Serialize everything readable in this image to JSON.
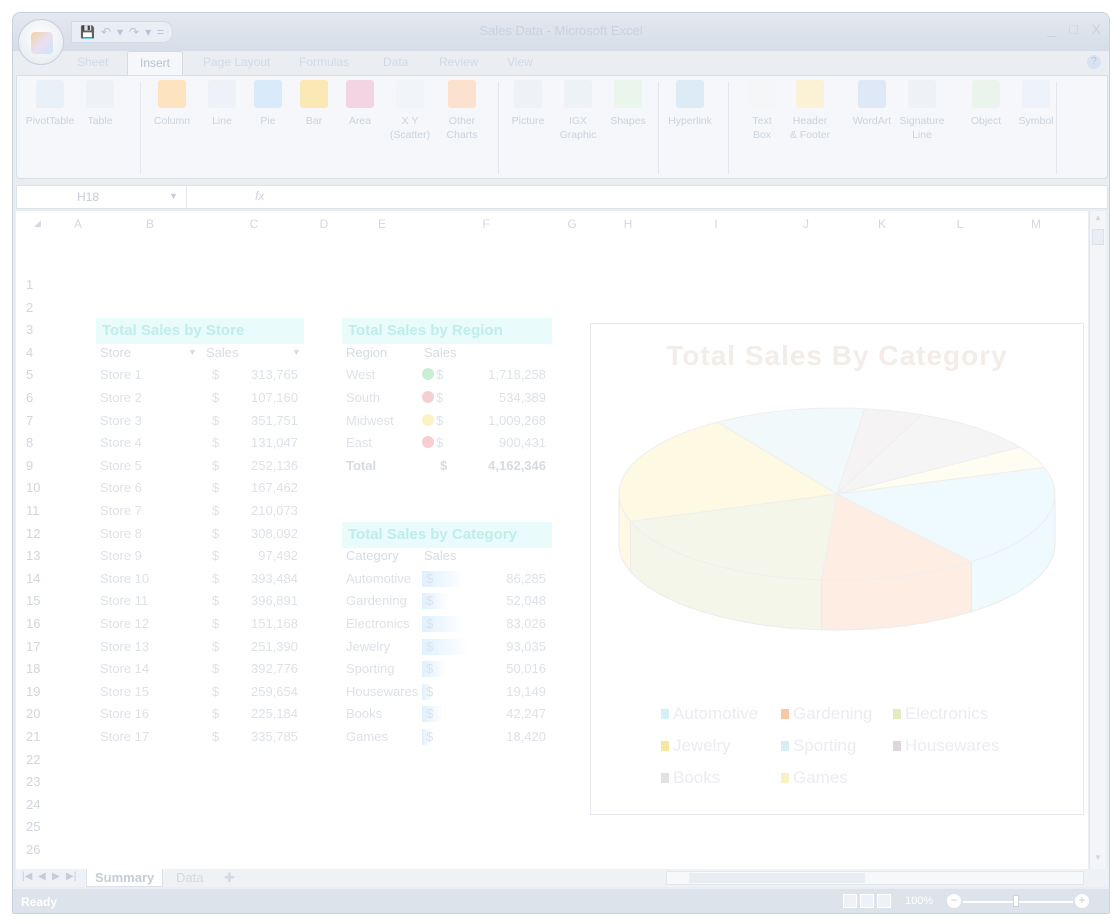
{
  "window": {
    "title": "Sales Data - Microsoft Excel",
    "controls": [
      "_",
      "□",
      "X"
    ]
  },
  "quick_access": [
    "💾",
    "↶",
    "▾",
    "↷",
    "▾",
    "="
  ],
  "tabs": [
    "Sheet",
    "Insert",
    "Page Layout",
    "Formulas",
    "Data",
    "Review",
    "View"
  ],
  "active_tab": "Insert",
  "ribbon": [
    {
      "label": "PivotTable",
      "icon": "pivottable-icon",
      "color": "#e9f0f7"
    },
    {
      "label": "Table",
      "icon": "table-icon",
      "color": "#eef2f7"
    },
    {
      "label": "Column",
      "icon": "column-chart-icon",
      "color": "#fde3c0"
    },
    {
      "label": "Line",
      "icon": "line-chart-icon",
      "color": "#eef2f8"
    },
    {
      "label": "Pie",
      "icon": "pie-chart-icon",
      "color": "#d9ebfa"
    },
    {
      "label": "Bar",
      "icon": "bar-chart-icon",
      "color": "#fbe9b5"
    },
    {
      "label": "Area",
      "icon": "area-chart-icon",
      "color": "#f3d4e2"
    },
    {
      "label": "X Y",
      "label2": "(Scatter)",
      "icon": "scatter-chart-icon",
      "color": "#f1f4f8"
    },
    {
      "label": "Other",
      "label2": "Charts",
      "icon": "other-charts-icon",
      "color": "#fbe2cf"
    },
    {
      "label": "Picture",
      "icon": "picture-icon",
      "color": "#eef2f7"
    },
    {
      "label": "IGX",
      "label2": "Graphic",
      "icon": "igx-graphic-icon",
      "color": "#edf2f7"
    },
    {
      "label": "Shapes",
      "icon": "shapes-icon",
      "color": "#eaf5ec"
    },
    {
      "label": "Hyperlink",
      "icon": "hyperlink-icon",
      "color": "#dcebf6"
    },
    {
      "label": "Text",
      "label2": "Box",
      "icon": "text-box-icon",
      "color": "#f4f6f8"
    },
    {
      "label": "Header",
      "label2": "& Footer",
      "icon": "header-footer-icon",
      "color": "#fbf2d6"
    },
    {
      "label": "WordArt",
      "icon": "wordart-icon",
      "color": "#dfe8f6"
    },
    {
      "label": "Signature",
      "label2": "Line",
      "icon": "signature-line-icon",
      "color": "#eef2f6"
    },
    {
      "label": "Object",
      "icon": "object-icon",
      "color": "#eaf4ec"
    },
    {
      "label": "Symbol",
      "icon": "symbol-icon",
      "color": "#eef2fa"
    }
  ],
  "formula_bar": {
    "name_box": "H18",
    "fx": "fx",
    "value": ""
  },
  "columns": [
    "A",
    "B",
    "C",
    "D",
    "E",
    "F",
    "G",
    "H",
    "I",
    "J",
    "K",
    "L",
    "M"
  ],
  "rows": [
    "1",
    "2",
    "3",
    "4",
    "5",
    "6",
    "7",
    "8",
    "9",
    "10",
    "11",
    "12",
    "13",
    "14",
    "15",
    "16",
    "17",
    "18",
    "19",
    "20",
    "21",
    "22",
    "23",
    "24",
    "25",
    "26"
  ],
  "store_table": {
    "title": "Total Sales by Store",
    "headers": [
      "Store",
      "Sales"
    ],
    "rows": [
      [
        "Store 1",
        "313,765"
      ],
      [
        "Store 2",
        "107,160"
      ],
      [
        "Store 3",
        "351,751"
      ],
      [
        "Store 4",
        "131,047"
      ],
      [
        "Store 5",
        "252,136"
      ],
      [
        "Store 6",
        "167,462"
      ],
      [
        "Store 7",
        "210,073"
      ],
      [
        "Store 8",
        "308,092"
      ],
      [
        "Store 9",
        "97,492"
      ],
      [
        "Store 10",
        "393,484"
      ],
      [
        "Store 11",
        "396,891"
      ],
      [
        "Store 12",
        "151,168"
      ],
      [
        "Store 13",
        "251,390"
      ],
      [
        "Store 14",
        "392,776"
      ],
      [
        "Store 15",
        "259,654"
      ],
      [
        "Store 16",
        "225,184"
      ],
      [
        "Store 17",
        "335,785"
      ]
    ],
    "currency": "$"
  },
  "region_table": {
    "title": "Total Sales by Region",
    "headers": [
      "Region",
      "Sales"
    ],
    "rows": [
      {
        "region": "West",
        "sales": "1,718,258",
        "status_color": "#c8efd2"
      },
      {
        "region": "South",
        "sales": "534,389",
        "status_color": "#f6cfd2"
      },
      {
        "region": "Midwest",
        "sales": "1,009,268",
        "status_color": "#fbf3c2"
      },
      {
        "region": "East",
        "sales": "900,431",
        "status_color": "#f6cfd2"
      }
    ],
    "total_label": "Total",
    "total_value": "4,162,346",
    "currency": "$"
  },
  "category_table": {
    "title": "Total Sales by Category",
    "headers": [
      "Category",
      "Sales"
    ],
    "rows": [
      {
        "category": "Automotive",
        "sales": "86,285",
        "bar": 0.93
      },
      {
        "category": "Gardening",
        "sales": "52,048",
        "bar": 0.56
      },
      {
        "category": "Electronics",
        "sales": "83,026",
        "bar": 0.89
      },
      {
        "category": "Jewelry",
        "sales": "93,035",
        "bar": 1.0
      },
      {
        "category": "Sporting",
        "sales": "50,016",
        "bar": 0.54
      },
      {
        "category": "Housewares",
        "sales": "19,149",
        "bar": 0.21
      },
      {
        "category": "Books",
        "sales": "42,247",
        "bar": 0.45
      },
      {
        "category": "Games",
        "sales": "18,420",
        "bar": 0.2
      }
    ],
    "currency": "$"
  },
  "chart_data": {
    "type": "pie",
    "title": "Total Sales By Category",
    "categories": [
      "Automotive",
      "Gardening",
      "Electronics",
      "Jewelry",
      "Sporting",
      "Housewares",
      "Books",
      "Games"
    ],
    "values": [
      86285,
      52048,
      83026,
      93035,
      50016,
      19149,
      42247,
      18420
    ],
    "colors": [
      "#eefafd",
      "#fdede3",
      "#f4f6ea",
      "#fdf9e3",
      "#f2f9fb",
      "#f6f3f4",
      "#f5f5f5",
      "#fffdf2"
    ],
    "legend_colors": [
      "#d6f0f8",
      "#f9c7a5",
      "#e3ecbe",
      "#fae6a4",
      "#d8eef5",
      "#dcd7da",
      "#e2e2e2",
      "#fbefc4"
    ],
    "legend": "bottom"
  },
  "sheet_tabs": [
    "Summary",
    "Data"
  ],
  "status": {
    "text": "Ready",
    "zoom": "100%"
  }
}
